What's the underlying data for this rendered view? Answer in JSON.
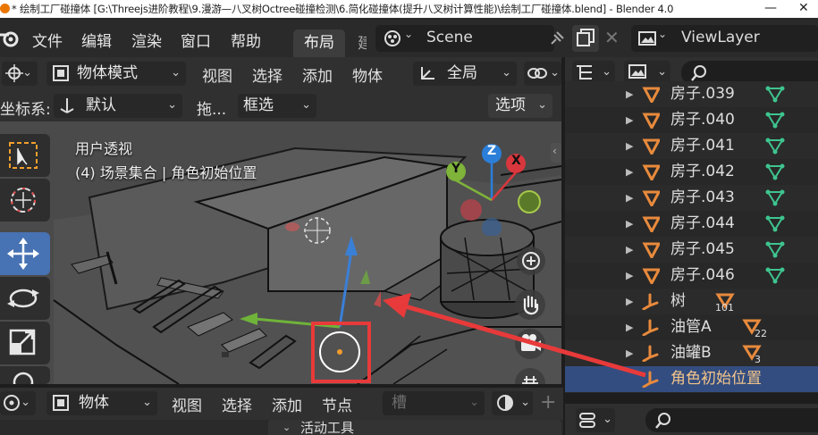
{
  "window": {
    "title": "* 绘制工厂碰撞体 [G:\\Threejs进阶教程\\9.漫游—八叉树Octree碰撞检测\\6.简化碰撞体(提升八叉树计算性能)\\绘制工厂碰撞体.blend] - Blender 4.0",
    "minimize_glyph": "—",
    "close_glyph": "✕"
  },
  "menubar": {
    "items": [
      "文件",
      "编辑",
      "渲染",
      "窗口",
      "帮助"
    ],
    "active_workspace": "布局",
    "partial_workspace": "建",
    "scene_name": "Scene",
    "view_layer": "ViewLayer"
  },
  "viewport_header": {
    "mode": "物体模式",
    "menus": [
      "视图",
      "选择",
      "添加",
      "物体"
    ],
    "transform_orientation": "全局"
  },
  "tool_header": {
    "coord_label": "坐标系:",
    "coord_value": "默认",
    "drag_label": "拖...",
    "drag_value": "框选",
    "options_label": "选项"
  },
  "viewport_overlay": {
    "view_name": "用户透视",
    "collection_info": "(4) 场景集合 | 角色初始位置"
  },
  "gizmo": {
    "axes": [
      "Z",
      "X",
      "Y"
    ],
    "colors": {
      "z": "#2b7fd9",
      "x": "#d8373d",
      "y": "#7fb33a"
    }
  },
  "outliner": {
    "rows": [
      {
        "label": "房子.039",
        "type": "mesh",
        "count": ""
      },
      {
        "label": "房子.040",
        "type": "mesh",
        "count": ""
      },
      {
        "label": "房子.041",
        "type": "mesh",
        "count": ""
      },
      {
        "label": "房子.042",
        "type": "mesh",
        "count": ""
      },
      {
        "label": "房子.043",
        "type": "mesh",
        "count": ""
      },
      {
        "label": "房子.044",
        "type": "mesh",
        "count": ""
      },
      {
        "label": "房子.045",
        "type": "mesh",
        "count": ""
      },
      {
        "label": "房子.046",
        "type": "mesh",
        "count": ""
      },
      {
        "label": "树",
        "type": "empty",
        "count": "101"
      },
      {
        "label": "油管A",
        "type": "empty",
        "count": "22"
      },
      {
        "label": "油罐B",
        "type": "empty",
        "count": "3"
      },
      {
        "label": "角色初始位置",
        "type": "empty-selected",
        "count": ""
      }
    ]
  },
  "bottom_header": {
    "editor": "物体",
    "menus": [
      "视图",
      "选择",
      "添加",
      "节点"
    ],
    "slot": "槽",
    "panel_title": "活动工具"
  },
  "colors": {
    "accent_blue": "#4772b3",
    "selection_row": "#334d80",
    "mesh_icon": "#e88a3c",
    "vertex_data_icon": "#3ec48f",
    "annotation_red": "#e83a3a"
  }
}
